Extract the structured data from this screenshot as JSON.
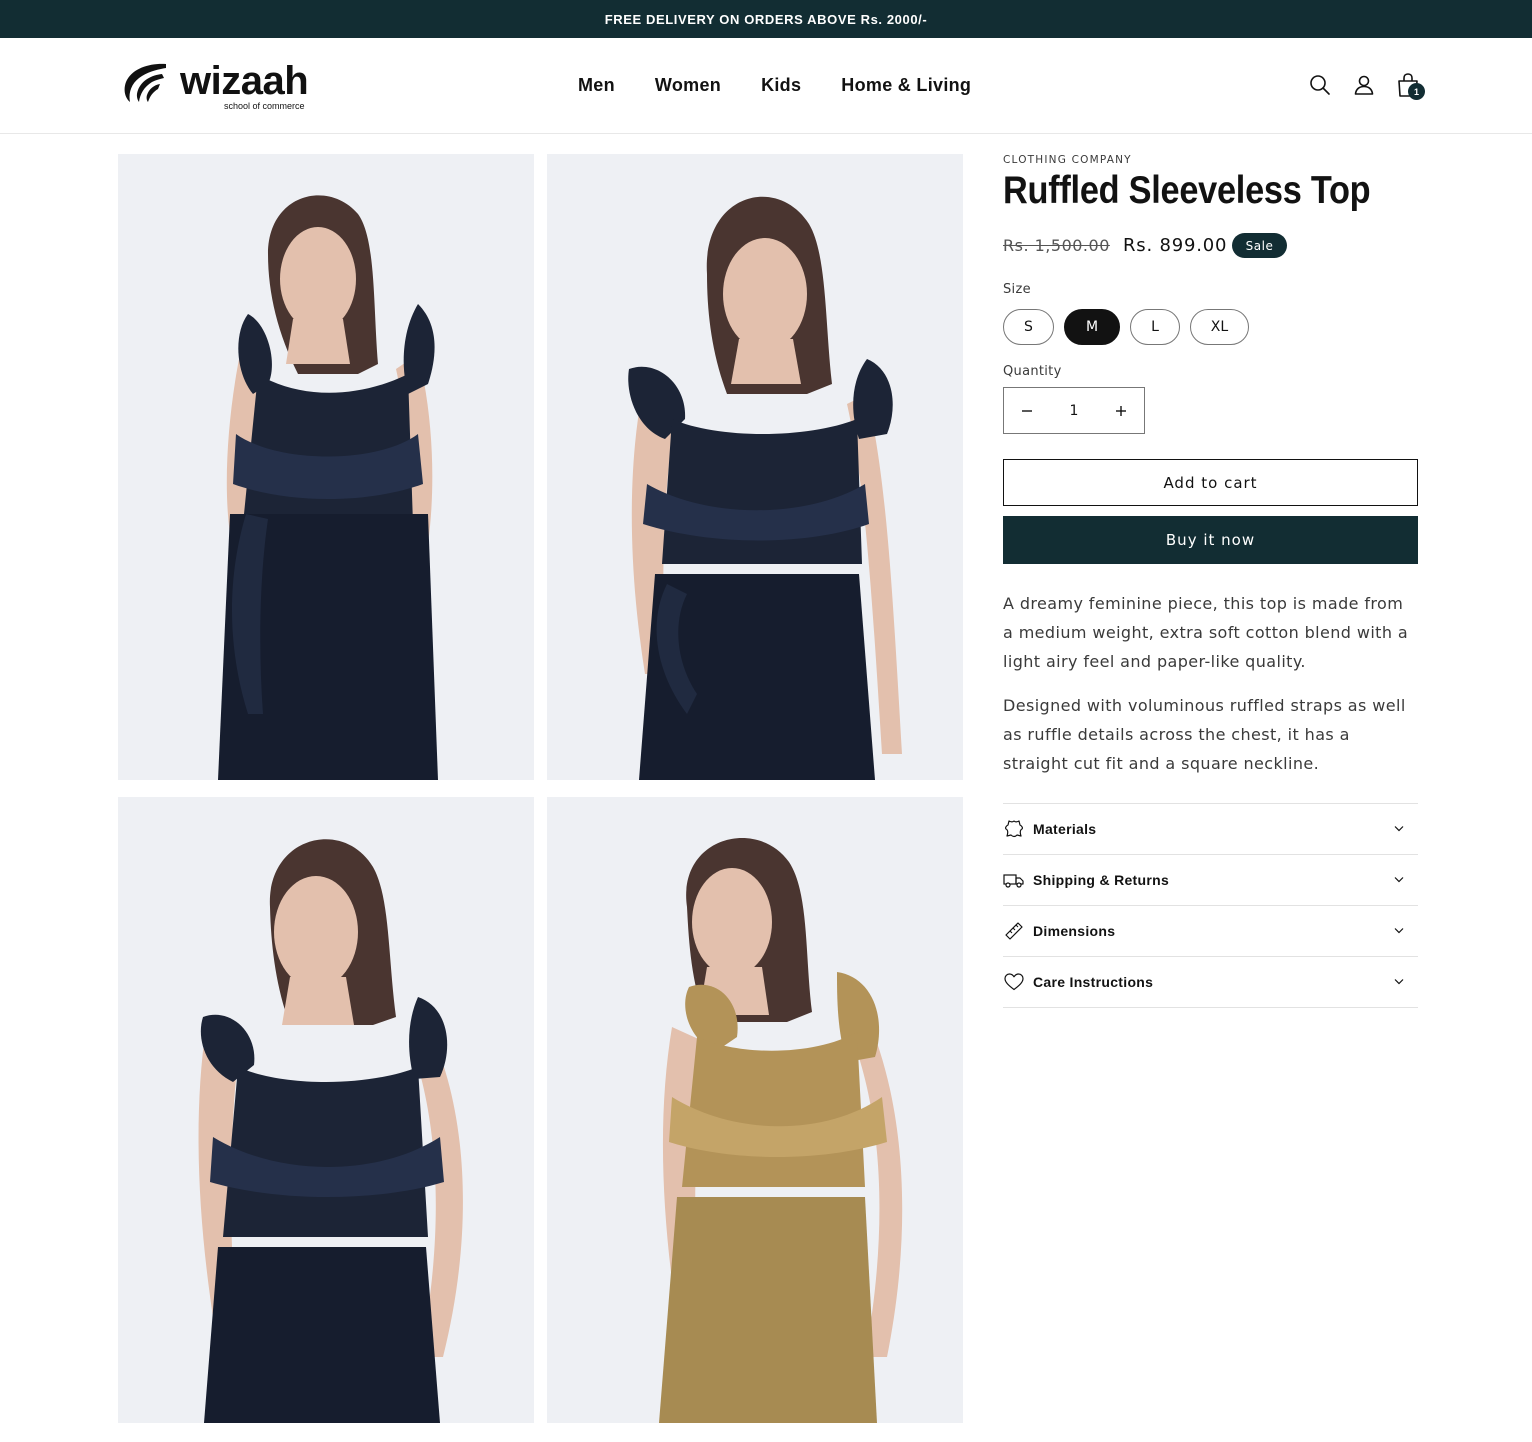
{
  "announcement": "FREE DELIVERY ON ORDERS ABOVE Rs. 2000/-",
  "brand": {
    "name": "wizaah",
    "tagline": "school of commerce"
  },
  "nav": [
    "Men",
    "Women",
    "Kids",
    "Home & Living"
  ],
  "header_icons": [
    "search-icon",
    "account-icon",
    "cart-icon"
  ],
  "cart": {
    "count": "1"
  },
  "gallery": {
    "images": [
      {
        "name": "navy-top-front",
        "color": "#1c2436"
      },
      {
        "name": "navy-top-close",
        "color": "#1c2436"
      },
      {
        "name": "navy-top-pose",
        "color": "#1c2436"
      },
      {
        "name": "khaki-top",
        "color": "#b39358"
      }
    ]
  },
  "product": {
    "vendor": "CLOTHING COMPANY",
    "title": "Ruffled Sleeveless Top",
    "price_compare": "Rs. 1,500.00",
    "price": "Rs. 899.00",
    "badge": "Sale",
    "size_label": "Size",
    "sizes": [
      "S",
      "M",
      "L",
      "XL"
    ],
    "selected_size": "M",
    "quantity_label": "Quantity",
    "quantity": "1",
    "add_to_cart": "Add to cart",
    "buy_now": "Buy it now",
    "description": [
      "A dreamy feminine piece, this top is made from a medium weight, extra soft cotton blend with a light airy feel and paper-like quality.",
      "Designed with voluminous ruffled straps as well as ruffle details across the chest, it has a straight cut fit and a square neckline."
    ],
    "accordion": [
      {
        "label": "Materials",
        "icon": "leather-icon"
      },
      {
        "label": "Shipping & Returns",
        "icon": "truck-icon"
      },
      {
        "label": "Dimensions",
        "icon": "ruler-icon"
      },
      {
        "label": "Care Instructions",
        "icon": "heart-icon"
      }
    ]
  },
  "colors": {
    "accent": "#122d33",
    "text": "#121212",
    "photo_bg": "#eef0f4"
  }
}
